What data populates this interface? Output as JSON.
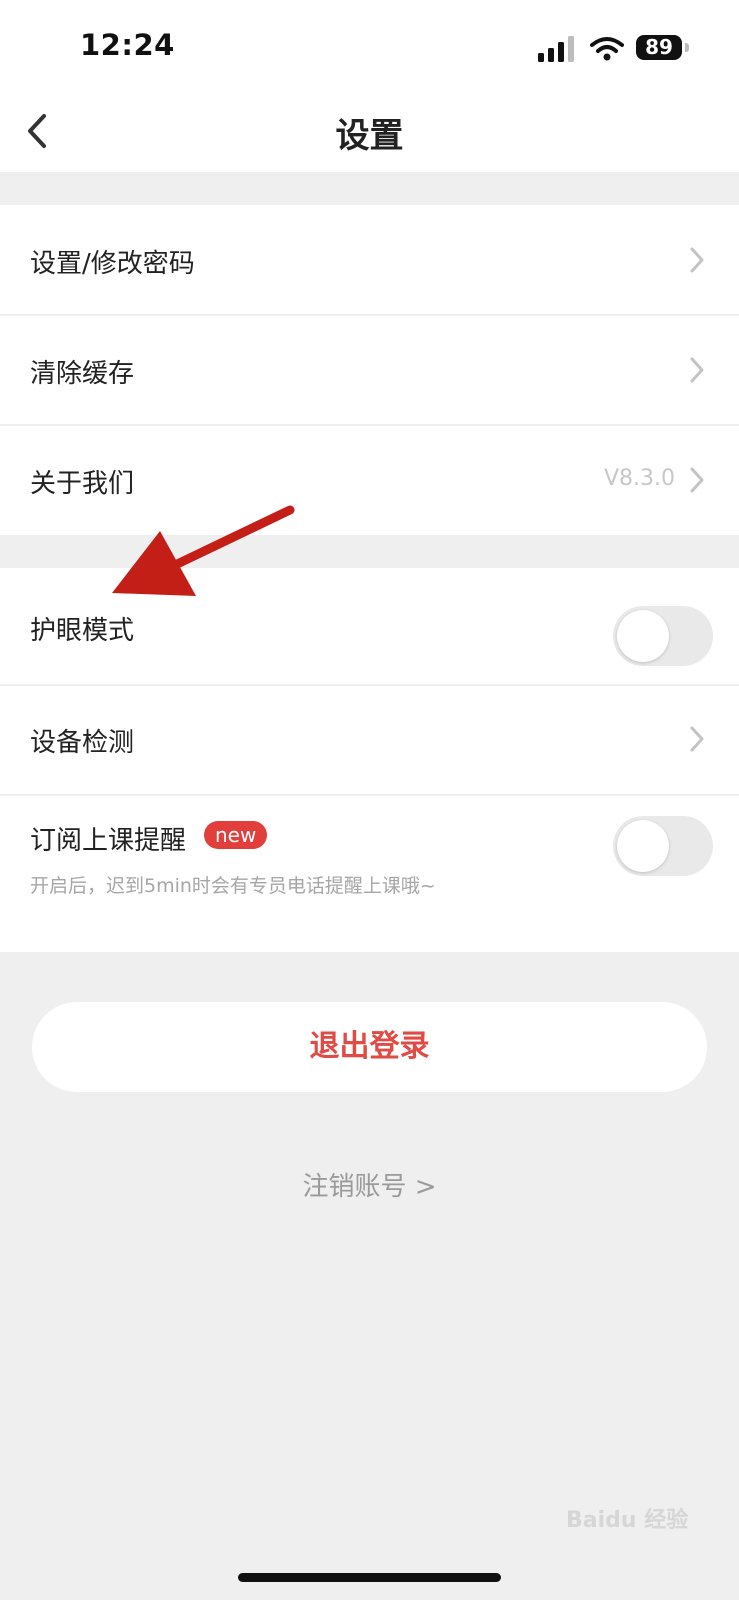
{
  "status_bar": {
    "time": "12:24",
    "battery_level": "89",
    "icons": [
      "cellular-signal-icon",
      "wifi-icon",
      "battery-icon"
    ]
  },
  "nav": {
    "title": "设置",
    "back_icon": "chevron-left-icon"
  },
  "settings_group_1": [
    {
      "label": "设置/修改密码",
      "icon": "chevron-right-icon"
    },
    {
      "label": "清除缓存",
      "icon": "chevron-right-icon"
    },
    {
      "label": "关于我们",
      "value": "V8.3.0",
      "icon": "chevron-right-icon"
    }
  ],
  "settings_group_2": {
    "eye_care": {
      "label": "护眼模式",
      "enabled": false
    },
    "device_check": {
      "label": "设备检测",
      "icon": "chevron-right-icon"
    },
    "class_reminder": {
      "label": "订阅上课提醒",
      "badge": "new",
      "description": "开启后，迟到5min时会有专员电话提醒上课哦~",
      "enabled": false
    }
  },
  "logout_button": "退出登录",
  "cancel_account_link": "注销账号 >",
  "watermark": "Baidu 经验",
  "colors": {
    "accent_red": "#e04b45",
    "badge_red": "#e23f3c",
    "annotation_arrow": "#c41f17",
    "page_background": "#efefef"
  }
}
